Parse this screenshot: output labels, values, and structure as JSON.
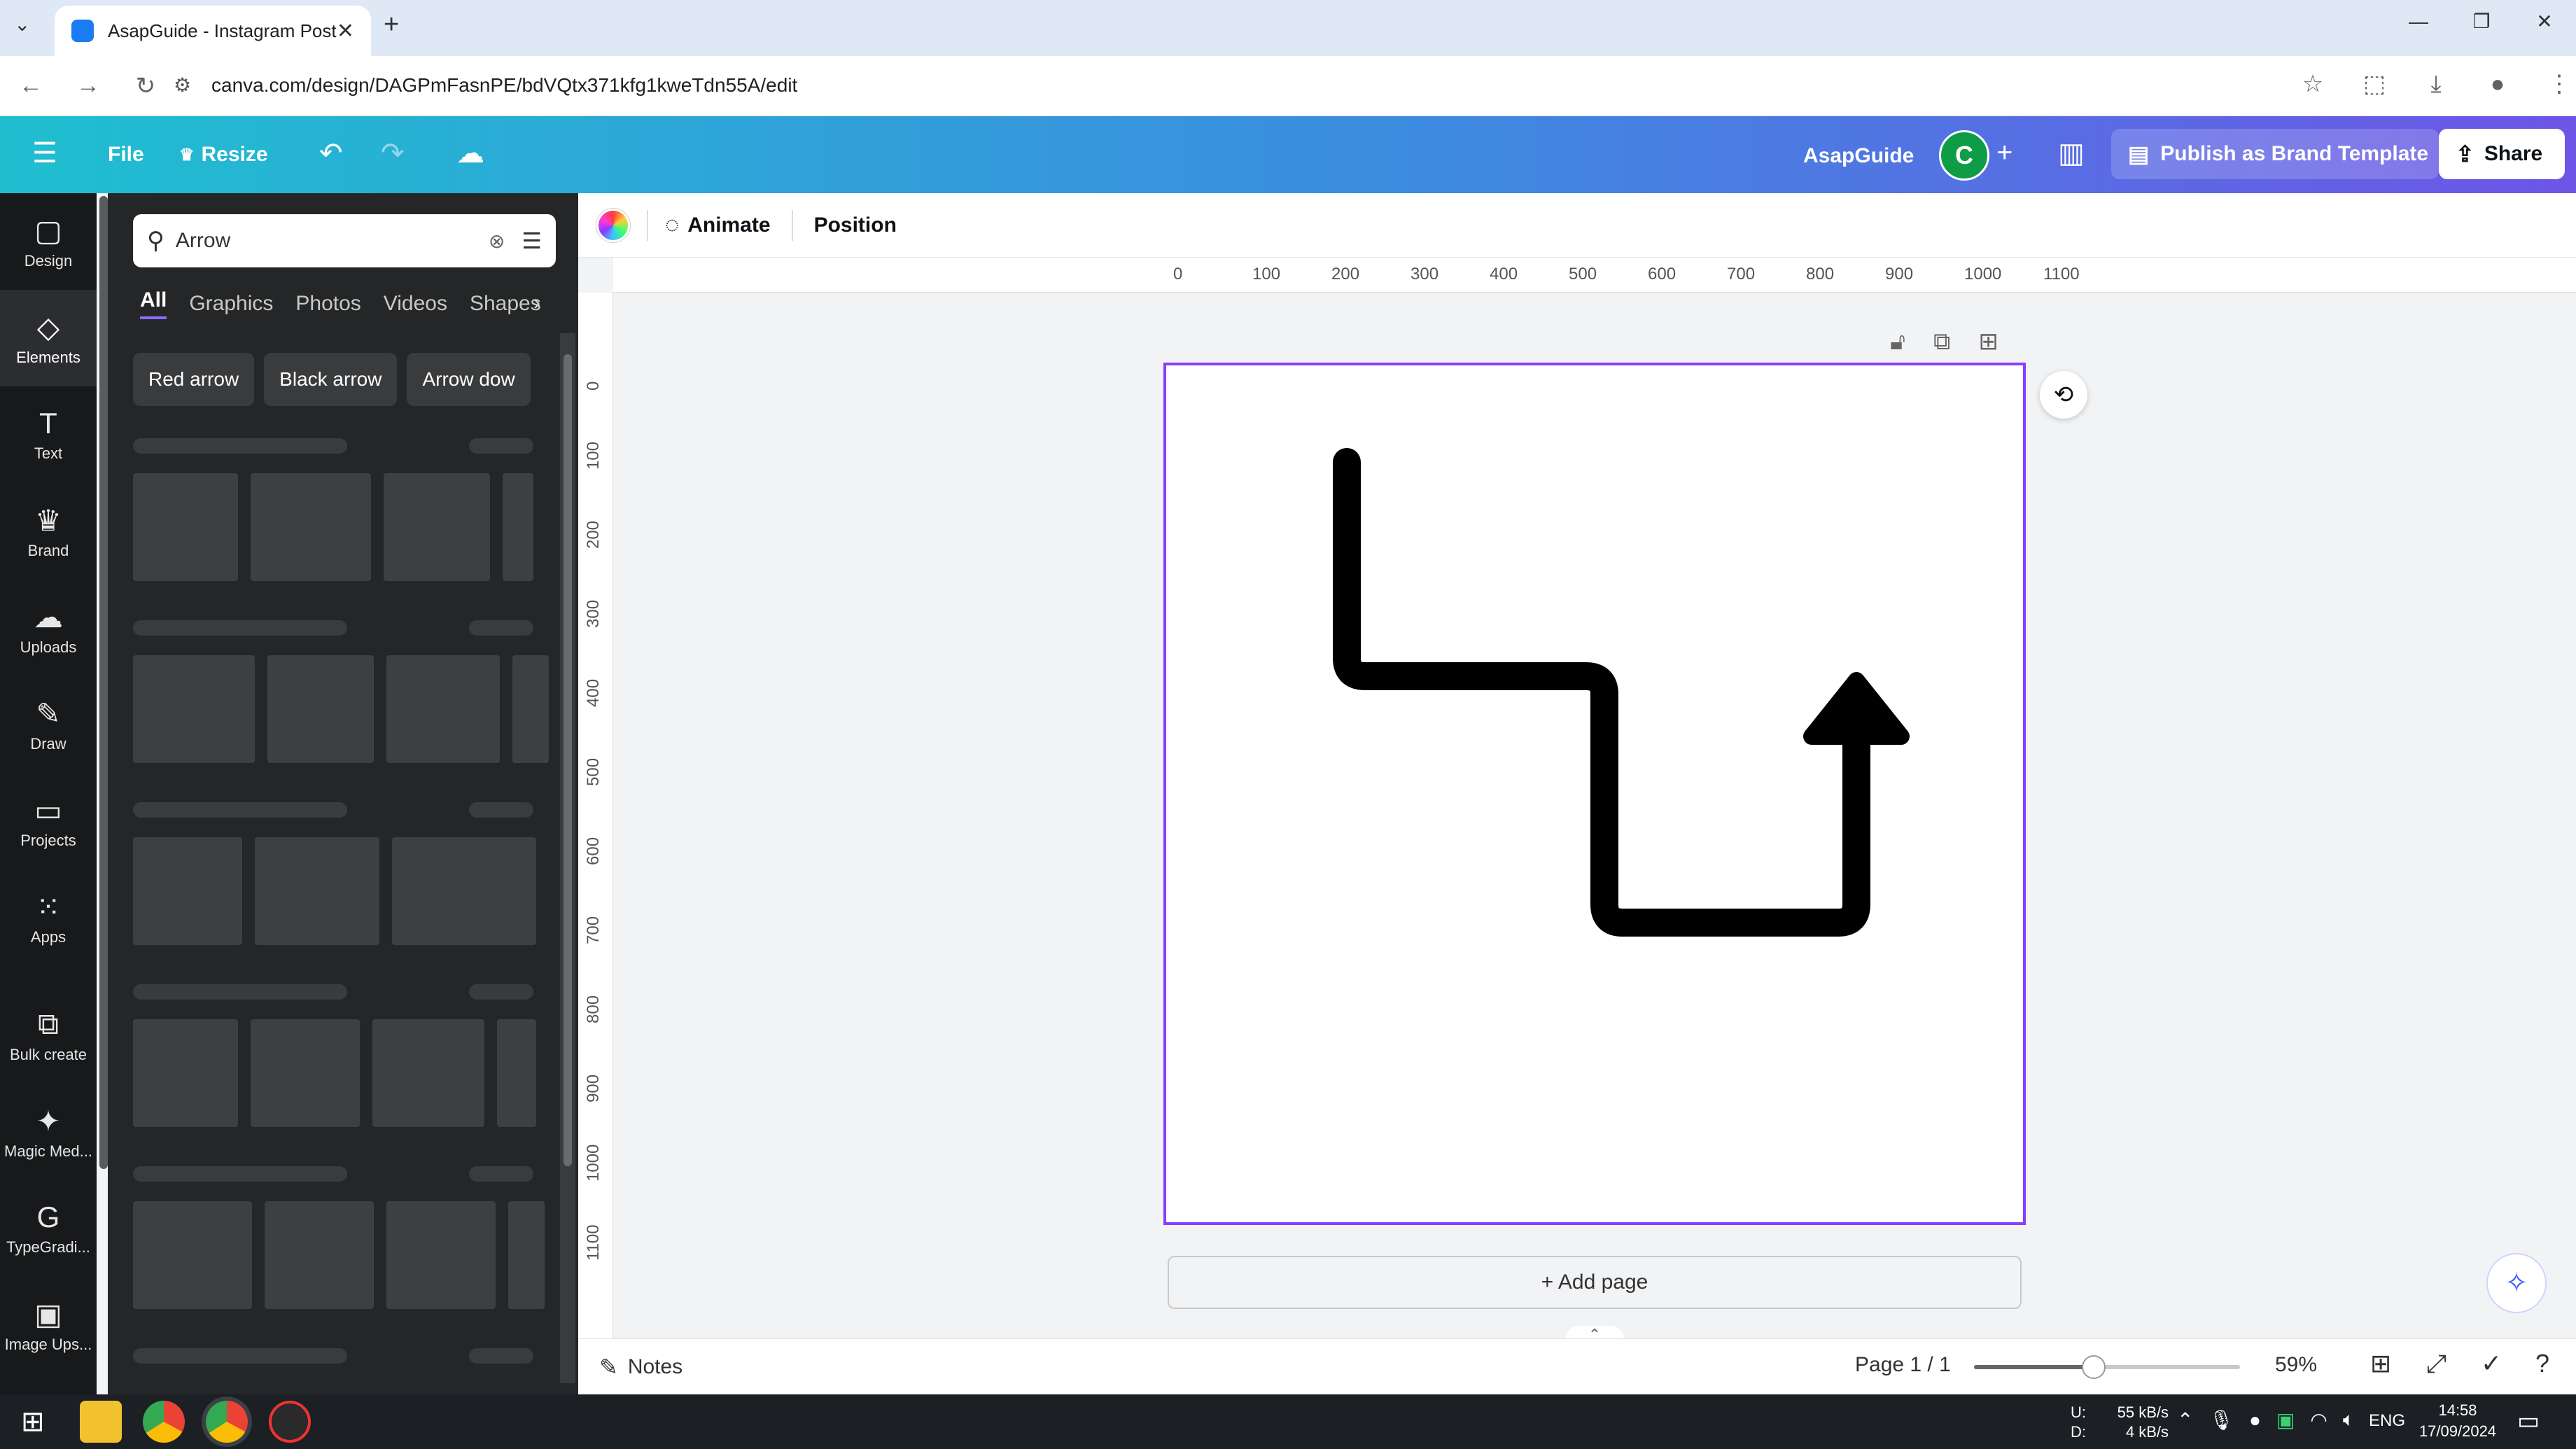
{
  "browser": {
    "tab_title": "AsapGuide - Instagram Post",
    "url": "canva.com/design/DAGPmFasnPE/bdVQtx371kfg1kweTdn55A/edit",
    "new_tab": "+",
    "tab_close": "✕"
  },
  "header": {
    "menu_icon": "☰",
    "file": "File",
    "resize": "Resize",
    "team_name": "AsapGuide",
    "avatar_letter": "C",
    "publish": "Publish as Brand Template",
    "share": "Share"
  },
  "rail": {
    "items": [
      {
        "label": "Design",
        "icon": "▢"
      },
      {
        "label": "Elements",
        "icon": "◇"
      },
      {
        "label": "Text",
        "icon": "T"
      },
      {
        "label": "Brand",
        "icon": "♛"
      },
      {
        "label": "Uploads",
        "icon": "☁"
      },
      {
        "label": "Draw",
        "icon": "✎"
      },
      {
        "label": "Projects",
        "icon": "▭"
      },
      {
        "label": "Apps",
        "icon": "⁙"
      },
      {
        "label": "Bulk create",
        "icon": "⧉"
      },
      {
        "label": "Magic Med...",
        "icon": "✦"
      },
      {
        "label": "TypeGradi...",
        "icon": "G"
      },
      {
        "label": "Image Ups...",
        "icon": "▣"
      }
    ]
  },
  "panel": {
    "search_value": "Arrow",
    "tabs": [
      "All",
      "Graphics",
      "Photos",
      "Videos",
      "Shapes"
    ],
    "chips": [
      "Red arrow",
      "Black arrow",
      "Arrow dow"
    ]
  },
  "toolbar": {
    "animate": "Animate",
    "position": "Position"
  },
  "rulers": {
    "horizontal": [
      "0",
      "100",
      "200",
      "300",
      "400",
      "500",
      "600",
      "700",
      "800",
      "900",
      "1000",
      "1100"
    ],
    "vertical": [
      "0",
      "100",
      "200",
      "300",
      "400",
      "500",
      "600",
      "700",
      "800",
      "900",
      "1000",
      "1100"
    ]
  },
  "canvas": {
    "add_page": "+ Add page"
  },
  "bottom": {
    "notes": "Notes",
    "page_indicator": "Page 1 / 1",
    "zoom": "59%",
    "zoom_level": 0.45
  },
  "taskbar": {
    "net_up": "55 kB/s",
    "net_down": "4 kB/s",
    "up_label": "U:",
    "down_label": "D:",
    "lang": "ENG",
    "time": "14:58",
    "date": "17/09/2024"
  }
}
